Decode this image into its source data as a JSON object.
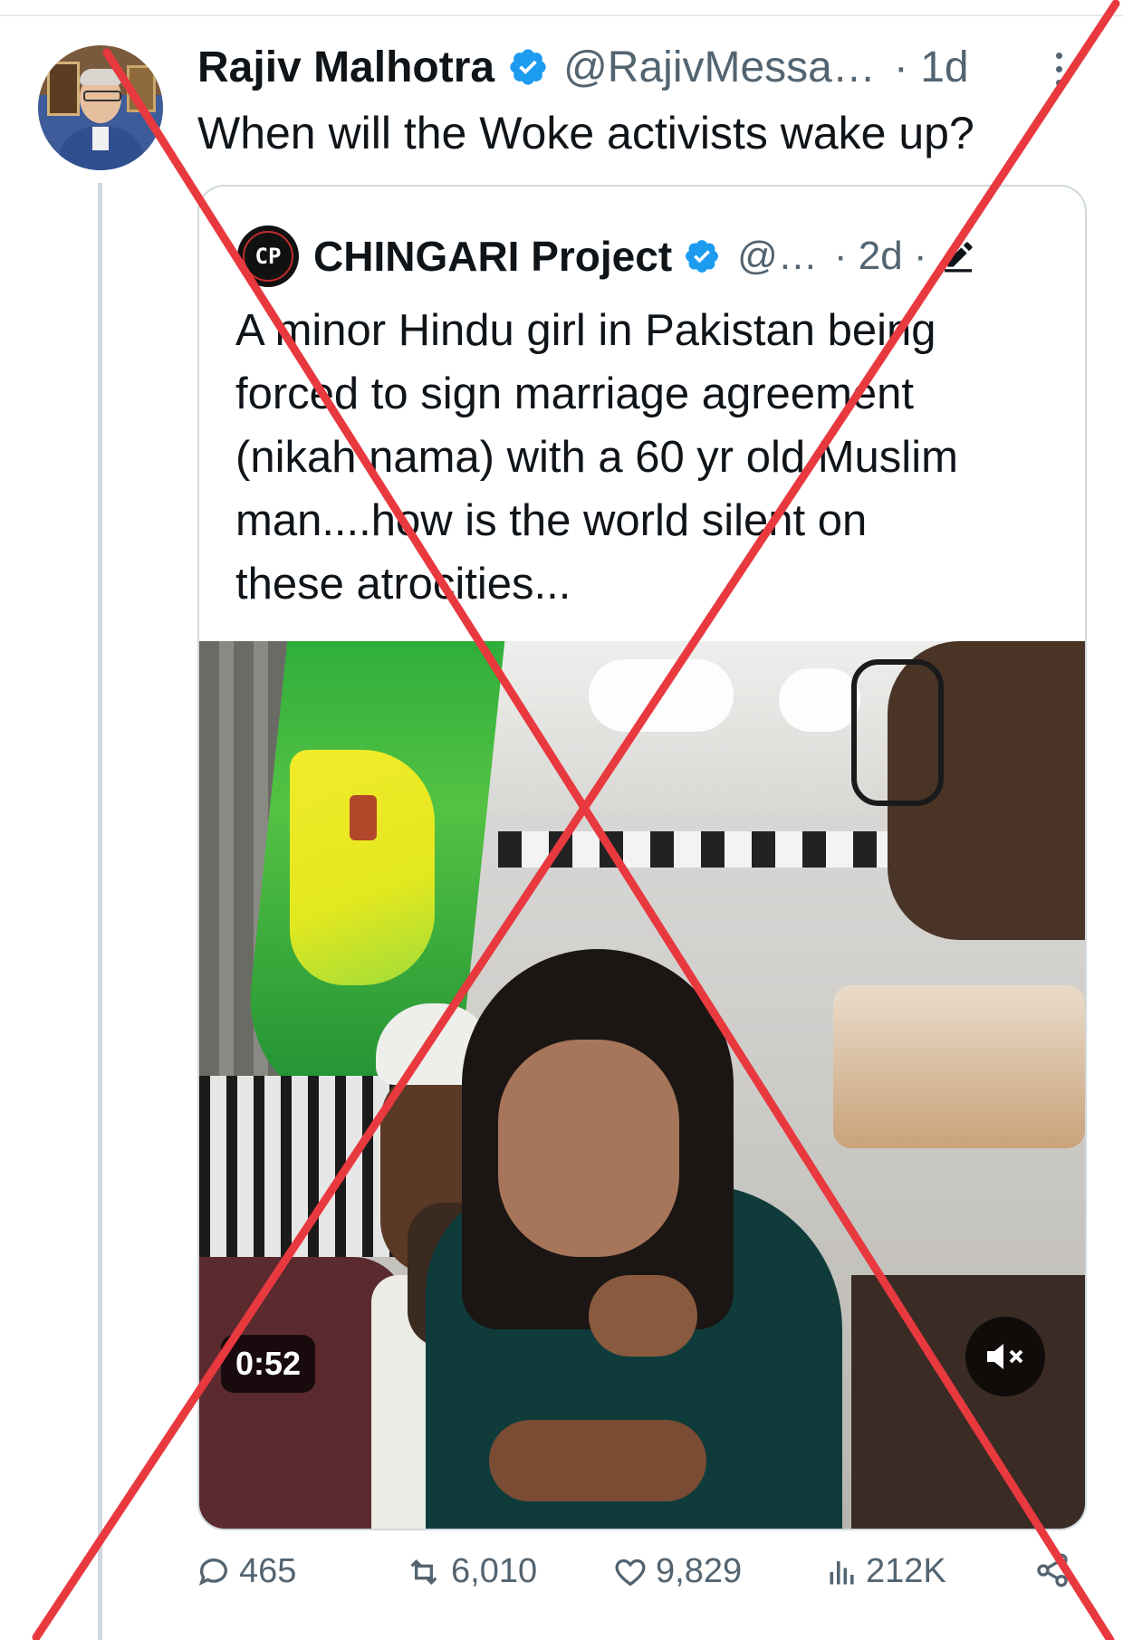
{
  "tweet": {
    "author_name": "Rajiv Malhotra",
    "handle": "@RajivMessa…",
    "time": "· 1d",
    "text": "When will the Woke activists wake up?",
    "verified_icon": "verified-badge-icon"
  },
  "quoted_tweet": {
    "author_name": "CHINGARI Project",
    "avatar_text": "CP",
    "handle": "@…",
    "time": "· 2d ·",
    "text_lines": [
      "A minor Hindu girl in Pakistan being",
      "forced to sign marriage agreement",
      "(nikah nama) with a 60 yr old Muslim",
      "man....how is the world silent on",
      "these atrocities..."
    ],
    "video": {
      "duration": "0:52",
      "muted": true
    }
  },
  "actions": {
    "replies": "465",
    "reposts": "6,010",
    "likes": "9,829",
    "views": "212K"
  },
  "colors": {
    "accent_blue": "#1d9bf0",
    "text_primary": "#0f1419",
    "text_secondary": "#536471",
    "cross_red": "#e8393f"
  }
}
